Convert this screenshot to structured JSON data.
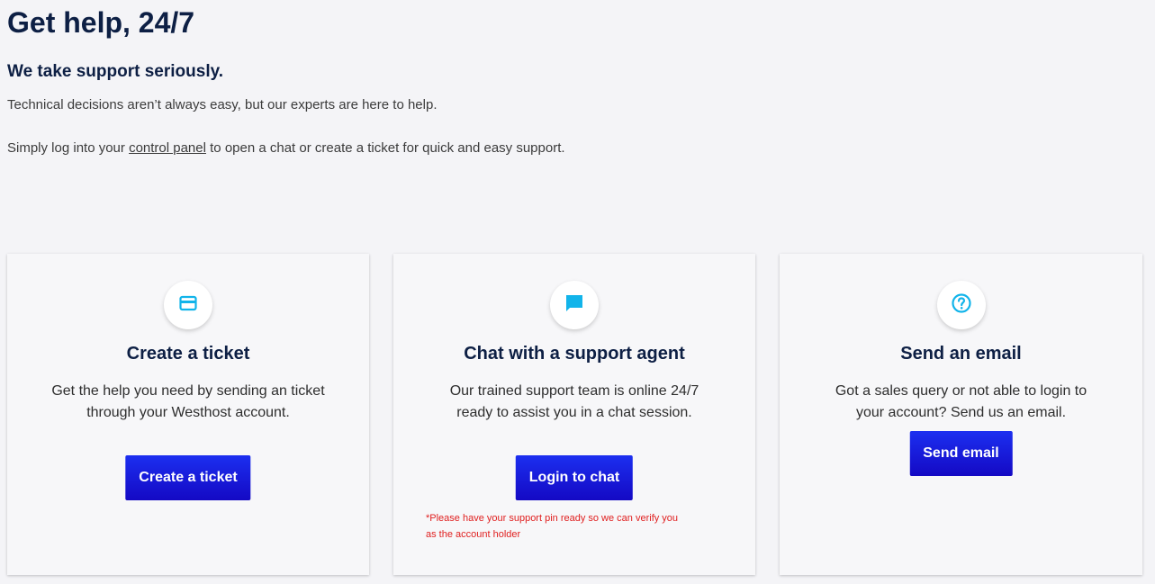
{
  "header": {
    "title": "Get help, 24/7",
    "subtitle": "We take support seriously.",
    "intro_line1": "Technical decisions aren’t always easy, but our experts are here to help.",
    "intro_line2_before": "Simply log into your ",
    "intro_link": "control panel",
    "intro_line2_after": " to open a chat or create a ticket for quick and easy support."
  },
  "cards": [
    {
      "icon": "card-icon",
      "title": "Create a ticket",
      "desc_line1": "Get the help you need by sending an ticket",
      "desc_line2": "through your Westhost account.",
      "button": "Create a ticket"
    },
    {
      "icon": "chat-bubble-icon",
      "title": "Chat with a support agent",
      "desc_line1": "Our trained support team is online 24/7",
      "desc_line2": "ready to assist you in a chat session.",
      "button": "Login to chat",
      "note_line1": "*Please have your support pin ready so we can verify you",
      "note_line2": "as the account holder"
    },
    {
      "icon": "question-circle-icon",
      "title": "Send an email",
      "desc_line1": "Got a sales query or not able to login to",
      "desc_line2": "your account? Send us an email.",
      "button": "Send email"
    }
  ],
  "colors": {
    "heading": "#0d1f44",
    "icon_accent": "#12b4ea",
    "button": "#1c2ff0",
    "note": "#e02020",
    "background": "#f4f4f7"
  }
}
